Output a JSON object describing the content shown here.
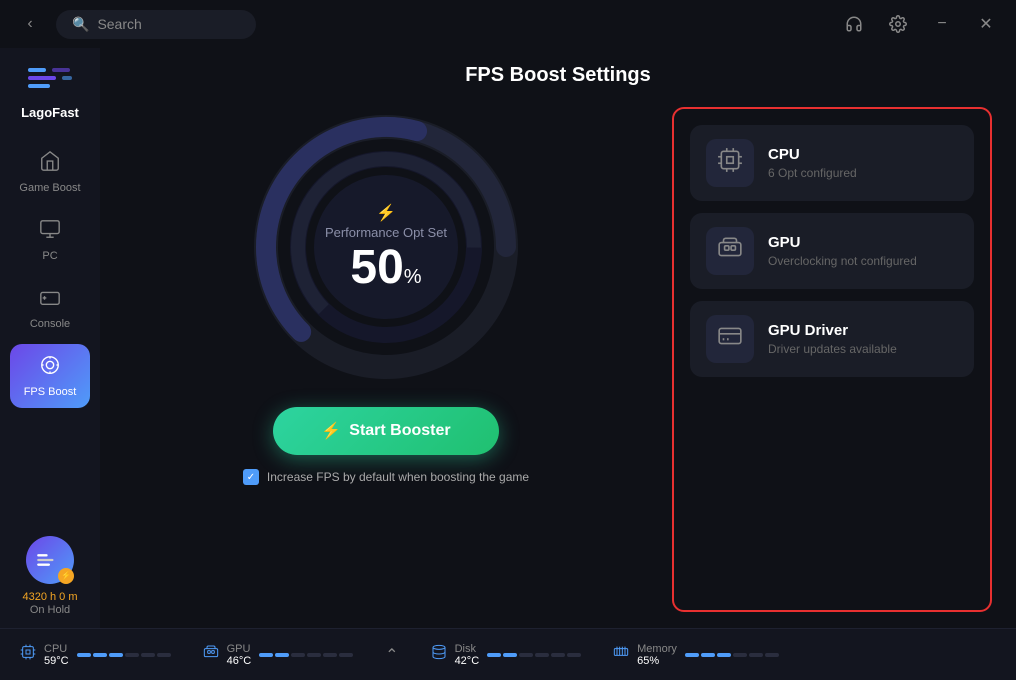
{
  "titlebar": {
    "back_label": "‹",
    "search_placeholder": "Search",
    "support_icon": "headset",
    "settings_icon": "gear",
    "minimize_icon": "−",
    "close_icon": "✕"
  },
  "sidebar": {
    "logo_text": "LagoFast",
    "items": [
      {
        "id": "game-boost",
        "label": "Game Boost",
        "icon": "⌂",
        "active": false
      },
      {
        "id": "pc",
        "label": "PC",
        "icon": "🖥",
        "active": false
      },
      {
        "id": "console",
        "label": "Console",
        "icon": "🎮",
        "active": false
      },
      {
        "id": "fps-boost",
        "label": "FPS Boost",
        "icon": "◎",
        "active": true
      }
    ],
    "user_time": "4320 h 0 m",
    "user_status": "On Hold"
  },
  "main": {
    "page_title": "FPS Boost Settings",
    "gauge": {
      "label": "Performance Opt Set",
      "value": "50",
      "unit": "%"
    },
    "boost_button": "Start Booster",
    "checkbox_label": "Increase FPS by default when boosting the game",
    "cards": [
      {
        "id": "cpu",
        "title": "CPU",
        "subtitle": "6 Opt configured",
        "icon": "cpu"
      },
      {
        "id": "gpu",
        "title": "GPU",
        "subtitle": "Overclocking not configured",
        "icon": "gpu"
      },
      {
        "id": "gpu-driver",
        "title": "GPU Driver",
        "subtitle": "Driver updates available",
        "icon": "driver"
      }
    ]
  },
  "statusbar": {
    "items": [
      {
        "id": "cpu",
        "name": "CPU",
        "value": "59°C",
        "bars": [
          1,
          1,
          1,
          0,
          0,
          0
        ]
      },
      {
        "id": "gpu",
        "name": "GPU",
        "value": "46°C",
        "bars": [
          1,
          1,
          0,
          0,
          0,
          0
        ]
      },
      {
        "id": "disk",
        "name": "Disk",
        "value": "42°C",
        "bars": [
          1,
          1,
          0,
          0,
          0,
          0
        ]
      },
      {
        "id": "memory",
        "name": "Memory",
        "value": "65%",
        "bars": [
          1,
          1,
          1,
          0,
          0,
          0
        ]
      }
    ]
  }
}
